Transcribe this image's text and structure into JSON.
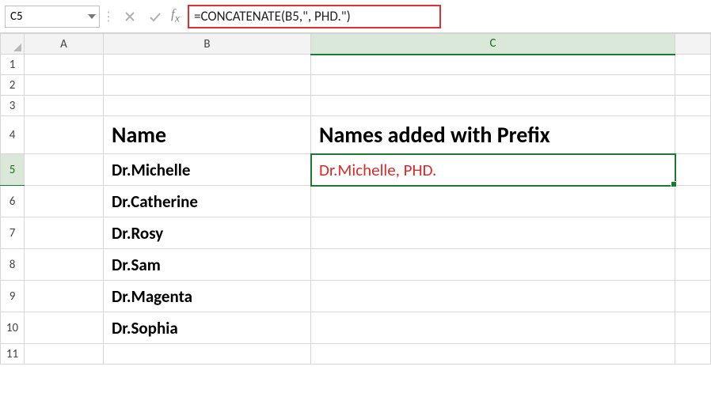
{
  "name_box": "C5",
  "formula": "=CONCATENATE(B5,\", PHD.\")",
  "col_headers": {
    "A": "A",
    "B": "B",
    "C": "C"
  },
  "rows": [
    "1",
    "2",
    "3",
    "4",
    "5",
    "6",
    "7",
    "8",
    "9",
    "10",
    "11"
  ],
  "headers": {
    "B": "Name",
    "C": "Names added with Prefix"
  },
  "data": {
    "B5": "Dr.Michelle",
    "B6": "Dr.Catherine",
    "B7": "Dr.Rosy",
    "B8": "Dr.Sam",
    "B9": "Dr.Magenta",
    "B10": "Dr.Sophia",
    "C5": "Dr.Michelle, PHD."
  },
  "selected_cell": "C5",
  "chart_data": {
    "type": "table",
    "title": "Names added with Prefix",
    "columns": [
      "Name",
      "Names added with Prefix"
    ],
    "rows": [
      [
        "Dr.Michelle",
        "Dr.Michelle, PHD."
      ],
      [
        "Dr.Catherine",
        ""
      ],
      [
        "Dr.Rosy",
        ""
      ],
      [
        "Dr.Sam",
        ""
      ],
      [
        "Dr.Magenta",
        ""
      ],
      [
        "Dr.Sophia",
        ""
      ]
    ]
  }
}
